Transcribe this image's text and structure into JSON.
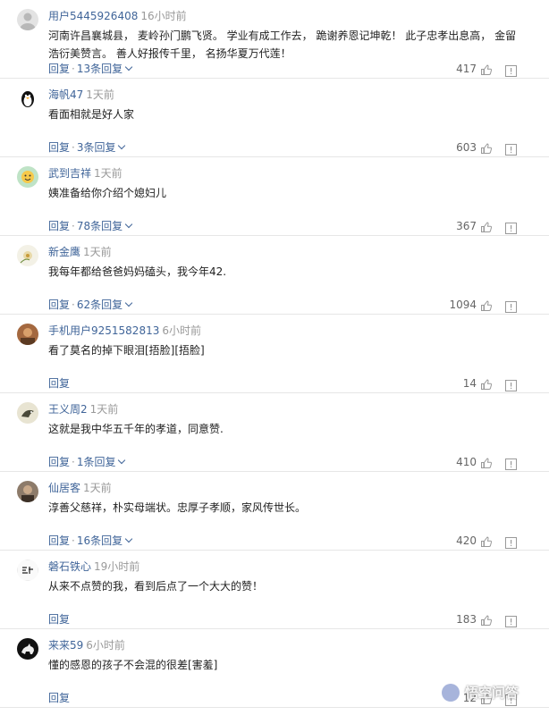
{
  "comments": [
    {
      "avatar": "default-user-avatar",
      "username": "用户5445926408",
      "time": "16小时前",
      "content": "河南许昌襄城县， 麦岭孙门鹏飞贤。 学业有成工作去， 跪谢养恩记坤乾！ 此子忠孝出息高， 金留浩衍美赞言。 善人好报传千里， 名扬华夏万代莲！",
      "reply_label": "回复",
      "sep": "·",
      "replies": "13条回复",
      "likes": "417"
    },
    {
      "avatar": "penguin-avatar",
      "username": "海帆47",
      "time": "1天前",
      "content": "看面相就是好人家",
      "reply_label": "回复",
      "sep": "·",
      "replies": "3条回复",
      "likes": "603"
    },
    {
      "avatar": "smiley-avatar",
      "username": "武到吉祥",
      "time": "1天前",
      "content": "姨准备给你介绍个媳妇儿",
      "reply_label": "回复",
      "sep": "·",
      "replies": "78条回复",
      "likes": "367"
    },
    {
      "avatar": "flower-avatar",
      "username": "新金鹰",
      "time": "1天前",
      "content": "我每年都给爸爸妈妈磕头，我今年42.",
      "reply_label": "回复",
      "sep": "·",
      "replies": "62条回复",
      "likes": "1094"
    },
    {
      "avatar": "photo-avatar",
      "username": "手机用户9251582813",
      "time": "6小时前",
      "content": "看了莫名的掉下眼泪[捂脸][捂脸]",
      "reply_label": "回复",
      "likes": "14"
    },
    {
      "avatar": "bird-avatar",
      "username": "王义周2",
      "time": "1天前",
      "content": "这就是我中华五千年的孝道，同意赞.",
      "reply_label": "回复",
      "sep": "·",
      "replies": "1条回复",
      "likes": "410"
    },
    {
      "avatar": "portrait-avatar",
      "username": "仙居客",
      "time": "1天前",
      "content": "淳善父慈祥，朴实母端状。忠厚子孝顺，家风传世长。",
      "reply_label": "回复",
      "sep": "·",
      "replies": "16条回复",
      "likes": "420"
    },
    {
      "avatar": "calligraphy-avatar",
      "username": "磐石铁心",
      "time": "19小时前",
      "content": "从来不点赞的我，看到后点了一个大大的赞！",
      "reply_label": "回复",
      "likes": "183"
    },
    {
      "avatar": "horse-avatar",
      "username": "来来59",
      "time": "6小时前",
      "content": "懂的感恩的孩子不会混的很差[害羞]",
      "reply_label": "回复",
      "likes": "12"
    }
  ],
  "watermark": {
    "text": "悟空问答"
  },
  "colors": {
    "link": "#406599",
    "muted": "#999999",
    "text": "#222222",
    "divider": "#e6e6e6"
  },
  "icons": {
    "like": "thumbs-up-icon",
    "report": "report-icon",
    "expand": "chevron-down-icon"
  }
}
